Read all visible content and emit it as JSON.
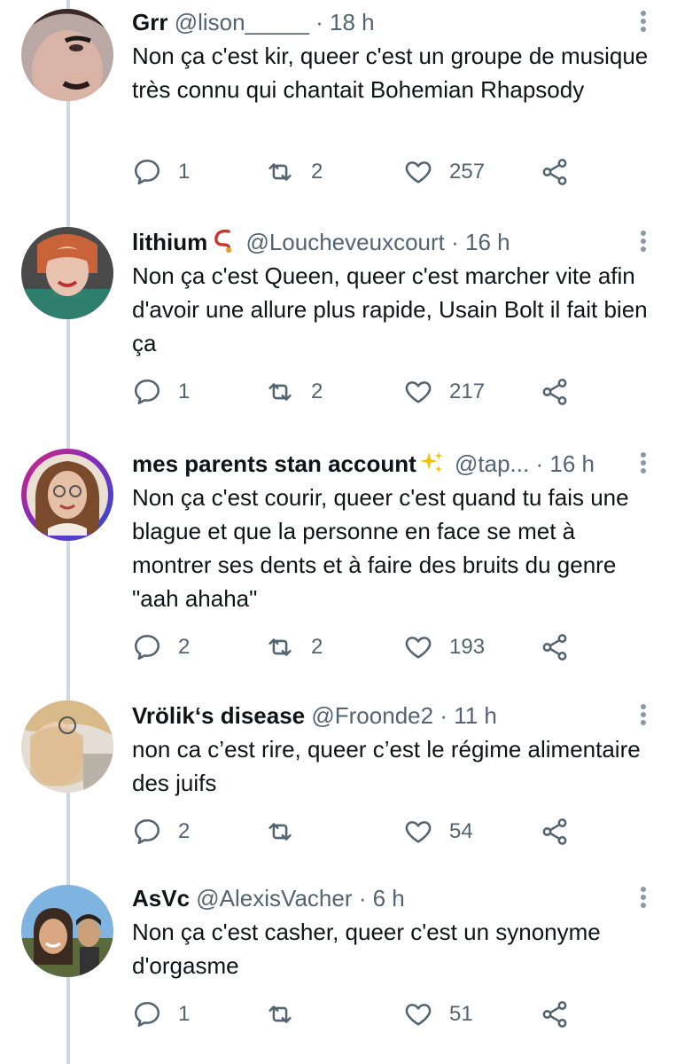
{
  "tweets": [
    {
      "name": "Grr",
      "handle": "@lison_____",
      "time": "18 h",
      "emoji": "",
      "text": "Non ça c'est kir, queer c'est un groupe de musique très connu qui chantait Bohemian Rhapsody",
      "replies": "1",
      "retweets": "2",
      "likes": "257",
      "avatar_colors": {
        "bg": "#b9a8a4",
        "skin": "#d9b3a6",
        "hair": "#3b2a26"
      }
    },
    {
      "name": "lithium",
      "handle": "@Loucheveuxcourt",
      "time": "16 h",
      "emoji": "beads-emoji",
      "text": "Non ça c'est Queen, queer c'est marcher vite afin d'avoir une allure plus rapide, Usain Bolt il fait bien ça",
      "replies": "1",
      "retweets": "2",
      "likes": "217",
      "avatar_colors": {
        "bg": "#4a4a4a",
        "skin": "#e8c3b0",
        "hair": "#c9643a"
      }
    },
    {
      "name": "mes parents stan account",
      "handle": "@tap...",
      "time": "16 h",
      "emoji": "sparkles-emoji",
      "text": "Non ça c'est courir, queer c'est quand tu fais une blague et que la personne en face se met à montrer ses dents et à faire des bruits du genre \"aah ahaha\"",
      "replies": "2",
      "retweets": "2",
      "likes": "193",
      "avatar_colors": {
        "bg": "#e9dfd3",
        "skin": "#e6c0a6",
        "hair": "#7a4a2c"
      }
    },
    {
      "name": "Vrölik‘s disease",
      "handle": "@Froonde2",
      "time": "11 h",
      "emoji": "",
      "text": "non ca c’est rire, queer c’est le régime alimentaire des juifs",
      "replies": "2",
      "retweets": "",
      "likes": "54",
      "avatar_colors": {
        "bg": "#e3ddd5",
        "skin": "#edc9ae",
        "hair": "#d8b98a"
      }
    },
    {
      "name": "AsVc",
      "handle": "@AlexisVacher",
      "time": "6 h",
      "emoji": "",
      "text": "Non ça c'est casher, queer c'est un synonyme d'orgasme",
      "replies": "1",
      "retweets": "",
      "likes": "51",
      "avatar_colors": {
        "bg": "#7fb3e0",
        "skin": "#d9a882",
        "hair": "#3a2a22"
      }
    }
  ],
  "colors": {
    "text": "#0f1419",
    "secondary": "#536471",
    "thread": "#cfd9de"
  },
  "separator": "·"
}
